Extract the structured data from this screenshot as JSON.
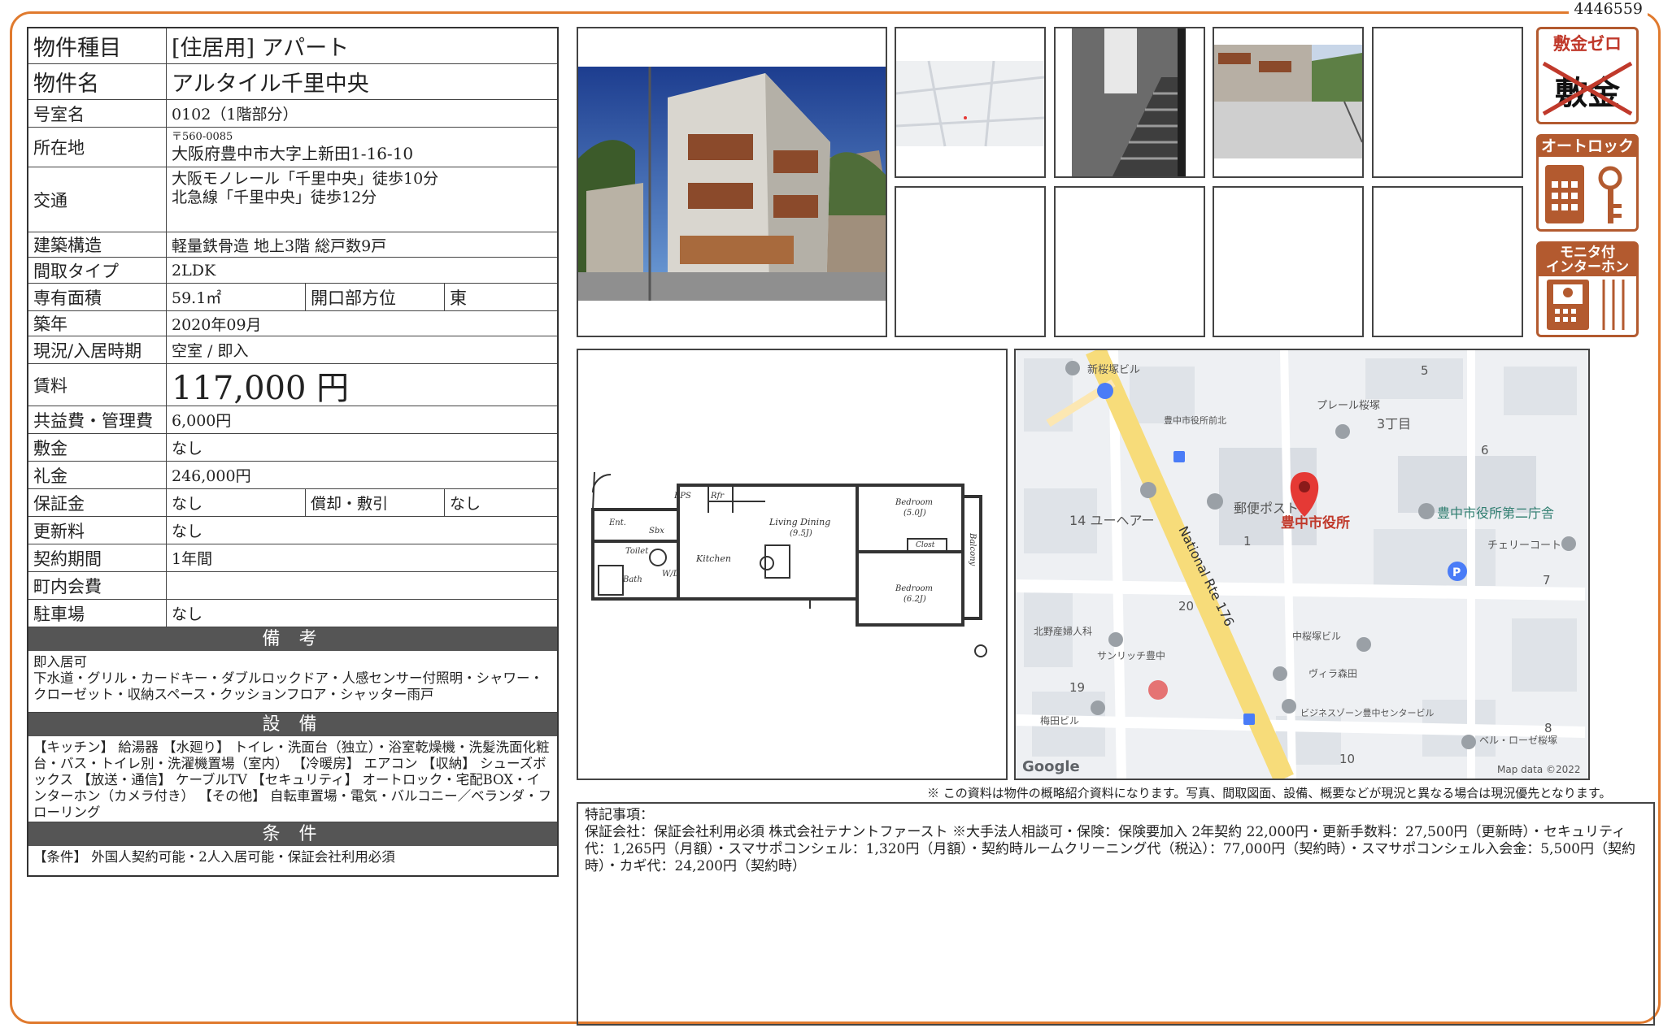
{
  "doc_id": "4446559",
  "property": {
    "type_label": "物件種目",
    "type_value": "[住居用]  アパート",
    "name_label": "物件名",
    "name_value": "アルタイル千里中央",
    "room_label": "号室名",
    "room_value": "0102（1階部分）",
    "address_label": "所在地",
    "postal": "〒560-0085",
    "address": "大阪府豊中市大字上新田1-16-10",
    "transit_label": "交通",
    "transit_1": "大阪モノレール「千里中央」徒歩10分",
    "transit_2": "北急線「千里中央」徒歩12分",
    "structure_label": "建築構造",
    "structure_value": "軽量鉄骨造  地上3階  総戸数9戸",
    "layout_label": "間取タイプ",
    "layout_value": "2LDK",
    "area_label": "専有面積",
    "area_value": "59.1㎡",
    "direction_label": "開口部方位",
    "direction_value": "東",
    "built_label": "築年",
    "built_value": "2020年09月",
    "status_label": "現況/入居時期",
    "status_value": "空室 /  即入",
    "rent_label": "賃料",
    "rent_value": "117,000 円",
    "fee_label": "共益費・管理費",
    "fee_value": "6,000円",
    "deposit_label": "敷金",
    "deposit_value": "なし",
    "key_money_label": "礼金",
    "key_money_value": "246,000円",
    "guarantee_label": "保証金",
    "guarantee_value": "なし",
    "amort_label": "償却・敷引",
    "amort_value": "なし",
    "renewal_label": "更新料",
    "renewal_value": "なし",
    "contract_label": "契約期間",
    "contract_value": "1年間",
    "community_label": "町内会費",
    "community_value": "",
    "parking_label": "駐車場",
    "parking_value": "なし"
  },
  "sections": {
    "remarks_title": "備 考",
    "remarks_text": "即入居可\n下水道・グリル・カードキー・ダブルロックドア・人感センサー付照明・シャワー・クローゼット・収納スペース・クッションフロア・シャッター雨戸",
    "equipment_title": "設 備",
    "equipment_text": "【キッチン】 給湯器 【水廻り】 トイレ・洗面台（独立）・浴室乾燥機・洗髪洗面化粧台・バス・トイレ別・洗濯機置場（室内） 【冷暖房】 エアコン 【収納】 シューズボックス 【放送・通信】 ケーブルTV 【セキュリティ】 オートロック・宅配BOX・インターホン（カメラ付き） 【その他】 自転車置場・電気・バルコニー／ベランダ・フローリング",
    "conditions_title": "条 件",
    "conditions_text": "【条件】 外国人契約可能・2人入居可能・保証会社利用必須"
  },
  "badges": {
    "zero_deposit": "敷金ゼロ",
    "zero_deposit_crossed": "敷金",
    "autolock": "オートロック",
    "monitor_1": "モニタ付",
    "monitor_2": "インターホン"
  },
  "floorplan": {
    "ent": "Ent.",
    "sbx": "Sbx",
    "eps": "EPS",
    "ref": "Rfr",
    "wd": "W/D",
    "bath": "Bath",
    "toilet": "Toilet",
    "living": "Living Dining",
    "living_size": "(9.5J)",
    "kitchen": "Kitchen",
    "bed1": "Bedroom",
    "bed1_size": "(5.0J)",
    "closet": "Clost",
    "balcony": "Balcony",
    "bed2": "Bedroom",
    "bed2_size": "(6.2J)"
  },
  "map": {
    "labels": {
      "shin_sakuraduka": "新桜塚ビル",
      "prele": "プレール桜塚",
      "chome3": "3丁目",
      "block5": "5",
      "block6": "6",
      "busstop": "豊中市役所前北",
      "yuheya": "14 ユーヘアー",
      "post": "郵便ポスト",
      "cityhall": "豊中市役所",
      "cityhall2": "豊中市役所第二庁舎",
      "cherry": "チェリーコート",
      "block7": "7",
      "block1": "1",
      "route": "National Rte 176",
      "block20": "20",
      "kitano": "北野産婦人科",
      "sunrich": "サンリッチ豊中",
      "naka": "中桜塚ビル",
      "villa": "ヴィラ森田",
      "block19": "19",
      "umeda": "梅田ビル",
      "bizzone": "ビジネスゾーン豊中センタービル",
      "block8": "8",
      "belrose": "ベル・ローゼ桜塚",
      "block10": "10",
      "google": "Google",
      "mapdata": "Map data ©2022"
    }
  },
  "disclaimer": "※ この資料は物件の概略紹介資料になります。写真、間取図面、設備、概要などが現況と異なる場合は現況優先となります。",
  "special_notes": {
    "heading": "特記事項：",
    "body": "保証会社：保証会社利用必須 株式会社テナントファースト ※大手法人相談可・保険：保険要加入 2年契約 22,000円・更新手数料：27,500円（更新時）・セキュリティ代：1,265円（月額）・スマサポコンシェル：1,320円（月額）・契約時ルームクリーニング代（税込）：77,000円（契約時）・スマサポコンシェル入会金：5,500円（契約時）・カギ代：24,200円（契約時）"
  },
  "colors": {
    "frame": "#e07a2e",
    "badge": "#b35a2f",
    "section": "#555555",
    "pin": "#e53935"
  }
}
